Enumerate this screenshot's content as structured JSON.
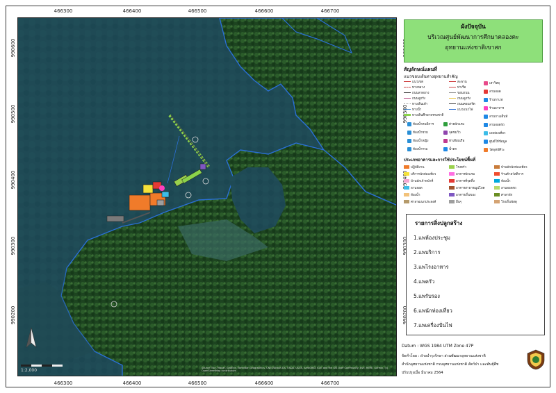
{
  "map": {
    "x_ticks": [
      "466300",
      "466400",
      "466500",
      "466600",
      "466700"
    ],
    "y_ticks": [
      "990600",
      "990500",
      "990400",
      "990300",
      "990200"
    ],
    "scale_text": "1:2,000",
    "attribution": "Source: Esri, Maxar, GeoEye, Earthstar Geographics, CNES/Airbus DS, USDA, USGS, AeroGRID, IGN, and the GIS User Community, Esri, HERE, Garmin, (c) OpenStreetMap contributors"
  },
  "title": {
    "line1": "ผังปัจจุบัน",
    "line2": "บริเวณศูนย์พัฒนาการศึกษาคลองคะ",
    "line3": "อุทยานแห่งชาติเขาสก"
  },
  "legend": {
    "heading": "สัญลักษณ์แผนที่",
    "sub1": "แนวขอบเส้นทางอุทยานสำคัญ",
    "lines_col1": [
      "แนวเขต",
      "ทางหลวง",
      "ถนนลาดยาง",
      "ถนนลูกรัง",
      "ทางเดินเท้า",
      "ทางน้ำ",
      "ทางเดินศึกษาธรรมชาติ"
    ],
    "lines_col2": [
      "สะพาน",
      "ท่าเรือ",
      "ขอบถนน",
      "ถนนลูกรัง",
      "ถนนคอนกรีต",
      "แนวแนวไฟ"
    ],
    "points_col1": [
      "ห้องน้ำคนพิการ",
      "ห้องน้ำชาย",
      "ห้องน้ำหญิง",
      "ห้องน้ำรวม"
    ],
    "points_col2": [
      "ค่ายพักแรม",
      "จุดชมวิว",
      "ท่าเทียบเรือ",
      "น้ำตก"
    ],
    "points_col3": [
      "เสาวิทยุ",
      "ลานจอด",
      "ร้านกาแฟ",
      "ร้านอาหาร",
      "ลานกางเต็นท์",
      "ลานจอดรถ",
      "แพท่องเที่ยว",
      "ศูนย์ให้ข้อมูล",
      "วัดพุทธ์ศิวะ"
    ],
    "sub2": "ประเภทอาคารและการใช้ประโยชน์พื้นที่",
    "areas_col1": [
      "ปฏิบัติงาน",
      "บริการนักท่องเที่ยว",
      "บ้านพักเจ้าหน้าที่",
      "ลานจอด",
      "ห้องน้ำ",
      "ศาลาอเนกประสงค์"
    ],
    "areas_col2": [
      "โรงครัว",
      "อาคารพักแรม",
      "อาคารที่จุดทิ้ง",
      "อาคารสาธารณูปโภค",
      "อาคารเก็บของ",
      "อื่นๆ"
    ],
    "areas_col3": [
      "บ้านพักนักท่องเที่ยว",
      "ร้านค้าสวัสดิการ",
      "ห้องน้ำ",
      "ลานจอดรถ",
      "ศาลาพัก",
      "โรงเก็บพัสดุ"
    ],
    "area_colors": [
      "#f07b2a",
      "#f5e23a",
      "#f4a6d2",
      "#3cbde8",
      "#f2c27a",
      "#b59a6a",
      "#9ad14d",
      "#ff6fe2",
      "#e53935",
      "#a0522d",
      "#7e57c2",
      "#9e9e9e",
      "#c97c3a",
      "#f04e2e",
      "#00aadd",
      "#b7d96b",
      "#6b8e23",
      "#d4a373"
    ]
  },
  "construction_list": {
    "title": "รายการสิ่งปลูกสร้าง",
    "items": [
      "1.แพห้องประชุม",
      "2.แพบริการ",
      "3.แพโรงอาหาร",
      "4.แพครัว",
      "5.แพรับรอง",
      "6.แพนักท่องเที่ยว",
      "7.แพเครื่องปั่นไฟ"
    ]
  },
  "footer": {
    "datum": "Datum   : WGS 1984 UTM Zone 47P",
    "prepared": "จัดทำโดย   : ฝ่ายบำรุงรักษา ส่วนพัฒนาอุทยานแห่งชาติ",
    "office": "สำนักอุทยานแห่งชาติ  กรมอุทยานแห่งชาติ สัตว์ป่า และพันธุ์พืช",
    "updated": "ปรับปรุงเมื่อ มีนาคม 2564"
  },
  "colors": {
    "water": "#1f4a55",
    "forest": "#1e4a22",
    "boundary": "#2a6fd6",
    "title_bg": "#8ee07a"
  }
}
